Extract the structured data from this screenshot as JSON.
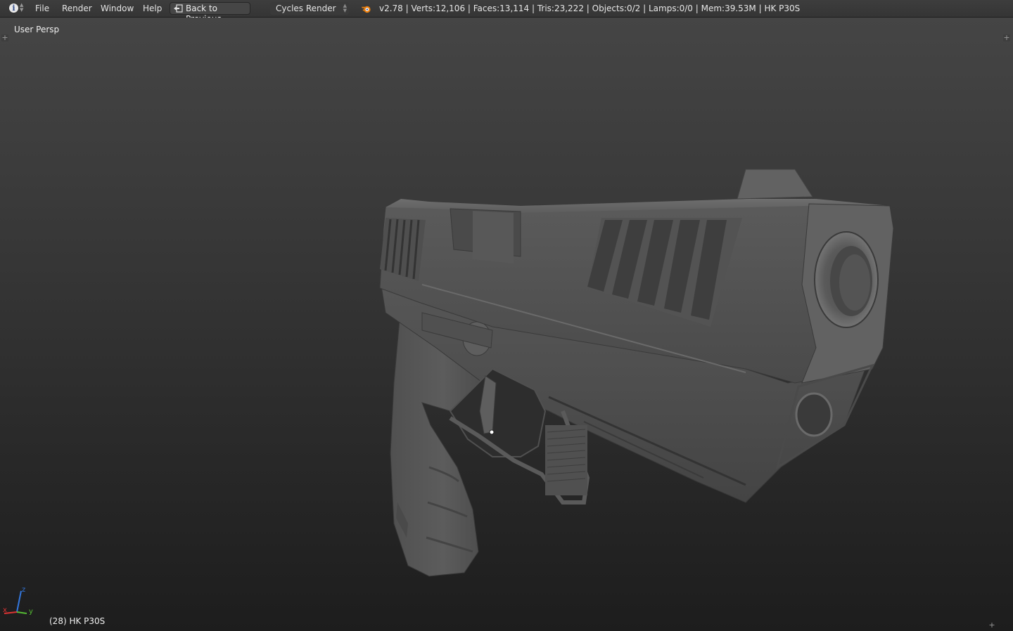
{
  "header": {
    "editor_type_icon": "info-icon",
    "menus": [
      "File",
      "Render",
      "Window",
      "Help"
    ],
    "back_button_label": "Back to Previous",
    "render_engine": "Cycles Render",
    "stats": "v2.78 | Verts:12,106 | Faces:13,114 | Tris:23,222 | Objects:0/2 | Lamps:0/0 | Mem:39.53M | HK P30S"
  },
  "viewport": {
    "view_name": "User Persp",
    "object_info": "(28) HK P30S",
    "axis_labels": {
      "x": "x",
      "y": "y",
      "z": "z"
    },
    "corner_glyph": "+"
  },
  "colors": {
    "header_bg": "#3a3a3a",
    "viewport_top": "#454545",
    "viewport_bottom": "#1d1d1d",
    "model_base": "#5c5c5c",
    "axis_x": "#dd3333",
    "axis_y": "#55bb33",
    "axis_z": "#3377dd"
  }
}
